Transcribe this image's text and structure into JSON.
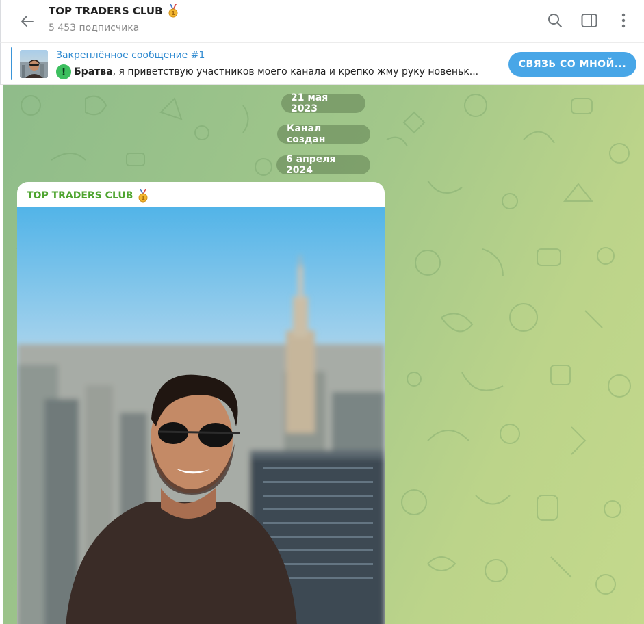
{
  "header": {
    "title": "TOP TRADERS CLUB",
    "title_badge_icon": "gold-medal-icon",
    "subscribers": "5 453 подписчика",
    "icons": [
      "back-arrow-icon",
      "search-icon",
      "sidebar-toggle-icon",
      "more-vertical-icon"
    ]
  },
  "pinned": {
    "title": "Закреплённое сообщение #1",
    "text_bold": "Братва",
    "text_rest": ", я приветствую участников моего канала и крепко жму руку новеньк...",
    "button_label": "СВЯЗЬ СО МНОЙ..."
  },
  "chat": {
    "dates": [
      "21 мая 2023",
      "Канал создан",
      "6 апреля 2024"
    ],
    "message": {
      "author": "TOP TRADERS CLUB"
    }
  },
  "colors": {
    "accent_blue": "#48a6e7",
    "pin_title": "#2f8ad0",
    "author_green": "#4ea42f",
    "date_pill": "#608052"
  }
}
